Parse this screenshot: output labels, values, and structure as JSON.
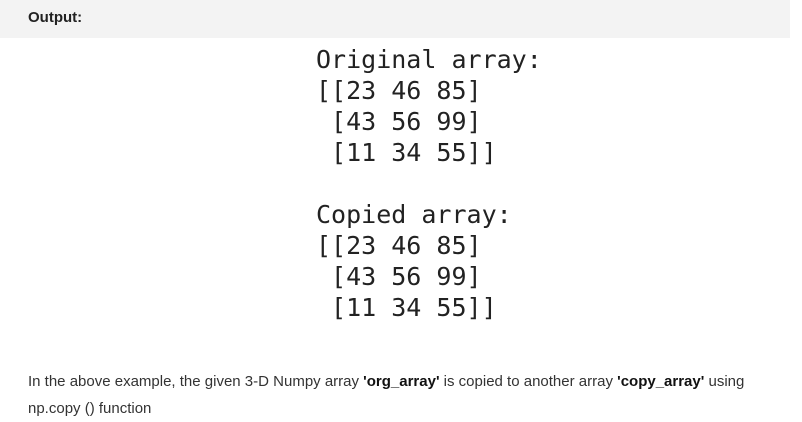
{
  "heading": {
    "label": "Output:"
  },
  "output": {
    "original": {
      "title": "Original array:",
      "rows": [
        "[[23 46 85]",
        " [43 56 99]",
        " [11 34 55]]"
      ]
    },
    "copied": {
      "title": "Copied array:",
      "rows": [
        "[[23 46 85]",
        " [43 56 99]",
        " [11 34 55]]"
      ]
    }
  },
  "description": {
    "part1": "In the above example, the given 3-D Numpy array ",
    "term1": "'org_array'",
    "part2": " is copied to another array ",
    "term2": "'copy_array'",
    "part3": " using np.copy () function"
  },
  "colors": {
    "heading_background": "#f3f3f3",
    "text": "#222222"
  }
}
